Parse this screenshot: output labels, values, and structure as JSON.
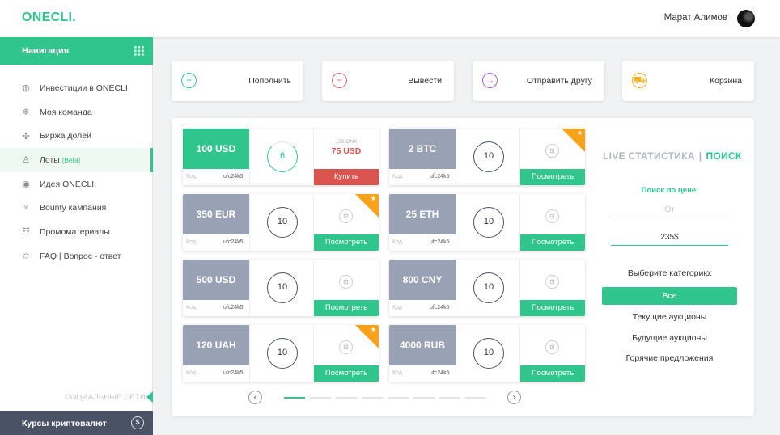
{
  "brand": {
    "logo": "ONECLI."
  },
  "user": {
    "name": "Марат Алимов"
  },
  "sidebar": {
    "header": "Навигация",
    "items": [
      {
        "label": "Инвестиции в ONECLI.",
        "icon": "investment-icon"
      },
      {
        "label": "Моя команда",
        "icon": "team-icon"
      },
      {
        "label": "Биржа долей",
        "icon": "exchange-icon"
      },
      {
        "label": "Лоты",
        "badge": "[Beta]",
        "icon": "lots-icon",
        "active": true
      },
      {
        "label": "Идея ONECLI.",
        "icon": "idea-icon"
      },
      {
        "label": "Bounty кампания",
        "icon": "bounty-icon"
      },
      {
        "label": "Промоматериалы",
        "icon": "promo-icon"
      },
      {
        "label": "FAQ | Вопрос - ответ",
        "icon": "faq-icon"
      }
    ],
    "social_label": "СОЦИАЛЬНЫЕ СЕТИ",
    "crypto_bar": "Курсы криптовалют"
  },
  "actions": [
    {
      "label": "Пополнить",
      "icon": "plus-icon",
      "color": "#2fc58c"
    },
    {
      "label": "Вывести",
      "icon": "minus-icon",
      "color": "#e06b75"
    },
    {
      "label": "Отправить другу",
      "icon": "arrow-right-icon",
      "color": "#b15fd6"
    },
    {
      "label": "Корзина",
      "icon": "cart-icon",
      "color": "#f2b01e"
    }
  ],
  "lots": [
    {
      "amount": "100 USD",
      "style": "green",
      "code_label": "Код",
      "code": "ufc24k5",
      "count": "6",
      "progress": true,
      "old_price": "150 ONX",
      "new_price": "75 USD",
      "button": "Купить",
      "buy": true,
      "featured": false
    },
    {
      "amount": "2 BTC",
      "style": "gray",
      "code_label": "Код",
      "code": "ufc24k5",
      "count": "10",
      "button": "Посмотреть",
      "featured": true
    },
    {
      "amount": "350 EUR",
      "style": "gray",
      "code_label": "Код",
      "code": "ufc24k5",
      "count": "10",
      "button": "Посмотреть",
      "featured": true
    },
    {
      "amount": "25 ETH",
      "style": "gray",
      "code_label": "Код",
      "code": "ufc24k5",
      "count": "10",
      "button": "Посмотреть",
      "featured": false
    },
    {
      "amount": "500 USD",
      "style": "gray",
      "code_label": "Код",
      "code": "ufc24k5",
      "count": "10",
      "button": "Посмотреть",
      "featured": false
    },
    {
      "amount": "800 CNY",
      "style": "gray",
      "code_label": "Код",
      "code": "ufc24k5",
      "count": "10",
      "button": "Посмотреть",
      "featured": false
    },
    {
      "amount": "120 UAH",
      "style": "gray",
      "code_label": "Код",
      "code": "ufc24k5",
      "count": "10",
      "button": "Посмотреть",
      "featured": true
    },
    {
      "amount": "4000 RUB",
      "style": "gray",
      "code_label": "Код",
      "code": "ufc24k5",
      "count": "10",
      "button": "Посмотреть",
      "featured": false
    }
  ],
  "pager": {
    "pages": 8,
    "current": 1
  },
  "stats": {
    "title_left": "LIVE СТАТИСТИКА",
    "separator": "|",
    "title_right": "ПОИСК",
    "price_search_label": "Поиск по цене:",
    "from_placeholder": "От",
    "to_value": "235$",
    "category_label": "Выберите категорию:",
    "categories": [
      {
        "label": "Все",
        "active": true
      },
      {
        "label": "Текущие аукционы"
      },
      {
        "label": "Будущие аукционы"
      },
      {
        "label": "Горячие предложения"
      }
    ]
  },
  "colors": {
    "accent": "#2fc58c",
    "danger": "#d9534f",
    "featured": "#f7a21b",
    "dark": "#4a5365"
  }
}
